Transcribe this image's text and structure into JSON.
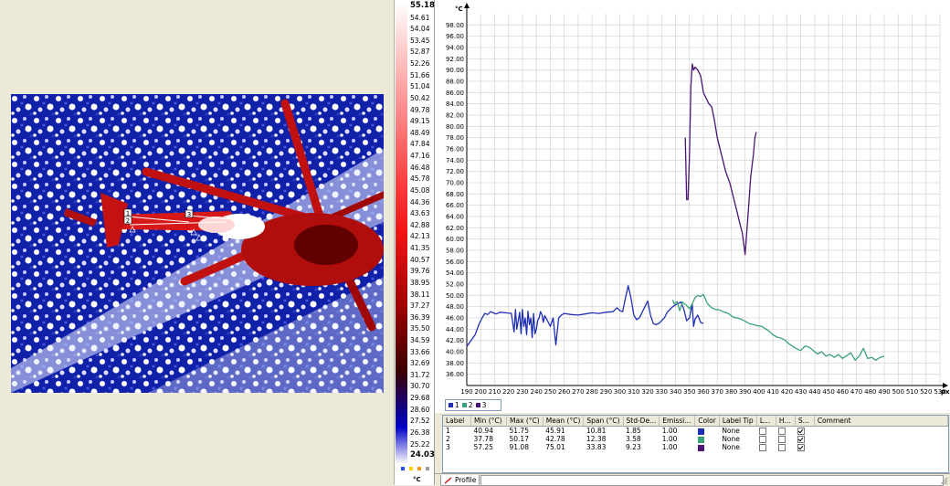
{
  "scale": {
    "labels": [
      "55.18",
      "54.61",
      "54.04",
      "53.45",
      "52.87",
      "52.26",
      "51.66",
      "51.04",
      "50.42",
      "49.78",
      "49.15",
      "48.49",
      "47.84",
      "47.16",
      "46.48",
      "45.78",
      "45.08",
      "44.36",
      "43.63",
      "42.88",
      "42.13",
      "41.35",
      "40.57",
      "39.76",
      "38.95",
      "38.11",
      "37.27",
      "36.39",
      "35.50",
      "34.59",
      "33.66",
      "32.69",
      "31.72",
      "30.70",
      "29.68",
      "28.60",
      "27.52",
      "26.38",
      "25.22",
      "24.03"
    ],
    "max": "55.18",
    "min": "24.03",
    "unit": "°C",
    "icon_colors": [
      "#2050ff",
      "#ffcc00",
      "#ff9a00",
      "#9c9c9c"
    ]
  },
  "image": {
    "markers": [
      "1",
      "2",
      "3"
    ]
  },
  "chart_data": {
    "type": "line",
    "ylabel": "°C",
    "xlabel": "px",
    "xlim": [
      190,
      530
    ],
    "ylim": [
      34,
      100
    ],
    "x_ticks": [
      190,
      200,
      210,
      220,
      230,
      240,
      250,
      260,
      270,
      280,
      290,
      300,
      310,
      320,
      330,
      340,
      350,
      360,
      370,
      380,
      390,
      400,
      410,
      420,
      430,
      440,
      450,
      460,
      470,
      480,
      490,
      500,
      510,
      520,
      530
    ],
    "y_ticks": [
      36,
      38,
      40,
      42,
      44,
      46,
      48,
      50,
      52,
      54,
      56,
      58,
      60,
      62,
      64,
      66,
      68,
      70,
      72,
      74,
      76,
      78,
      80,
      82,
      84,
      86,
      88,
      90,
      92,
      94,
      96,
      98
    ],
    "grid": true,
    "legend_position": "bottom-left",
    "series": [
      {
        "name": "1",
        "color": "#1f2fb5",
        "x": [
          190,
          193,
          196,
          199,
          201,
          203,
          205,
          207,
          209,
          211,
          214,
          218,
          222,
          224,
          225,
          226,
          228,
          229,
          230,
          231,
          232,
          233,
          234,
          235,
          236,
          237,
          238,
          239,
          240,
          241,
          242,
          243,
          244,
          245,
          246,
          248,
          250,
          252,
          254,
          256,
          258,
          260,
          265,
          270,
          275,
          280,
          285,
          290,
          295,
          298,
          300,
          302,
          304,
          306,
          308,
          310,
          312,
          314,
          316,
          318,
          320,
          322,
          324,
          326,
          328,
          330,
          332,
          334,
          336,
          338,
          340,
          342,
          344,
          346,
          348,
          350,
          352,
          353,
          354,
          356,
          358,
          360
        ],
        "values": [
          40.9,
          42,
          43,
          45,
          46,
          46.8,
          46.6,
          47.1,
          46.9,
          46.7,
          47,
          46.9,
          46.8,
          43.5,
          47.5,
          44,
          47,
          43.2,
          47.5,
          44.5,
          46,
          43,
          47.2,
          44.8,
          46,
          42.5,
          46.8,
          43.2,
          44,
          45.6,
          46,
          47.1,
          46.6,
          45.2,
          46.4,
          45.5,
          44.5,
          46,
          41.2,
          46,
          46.5,
          46.8,
          46.6,
          46.5,
          46.7,
          46.9,
          46.8,
          47,
          47.1,
          47.8,
          47.3,
          47.1,
          49.5,
          51.7,
          49.5,
          46.5,
          45.7,
          46,
          47,
          48,
          49,
          46.5,
          45,
          44.8,
          45,
          45.5,
          46,
          47,
          47.5,
          48,
          48.3,
          48.6,
          48.8,
          47.5,
          45.5,
          46,
          48.5,
          44.5,
          45.8,
          46.5,
          45.2,
          45
        ]
      },
      {
        "name": "2",
        "color": "#3aa077",
        "x": [
          338,
          339,
          341,
          343,
          345,
          348,
          350,
          352,
          354,
          356,
          358,
          360,
          363,
          366,
          369,
          372,
          375,
          378,
          381,
          384,
          387,
          390,
          393,
          396,
          399,
          402,
          405,
          408,
          410,
          413,
          416,
          419,
          421,
          424,
          427,
          430,
          433,
          436,
          439,
          442,
          445,
          448,
          451,
          454,
          457,
          460,
          463,
          466,
          469,
          472,
          475,
          478,
          481,
          484,
          487,
          490
        ],
        "values": [
          49.2,
          48.5,
          48.9,
          47.3,
          48.8,
          48.2,
          47.6,
          48.5,
          49.6,
          50,
          49.8,
          50.17,
          48.5,
          47.8,
          47.5,
          47.4,
          47,
          46.8,
          46.2,
          46,
          45.8,
          45.4,
          45,
          44.8,
          44.6,
          44.5,
          44,
          43.5,
          43,
          42.6,
          42.4,
          42,
          41.5,
          41,
          40.5,
          40.2,
          41,
          40.8,
          40.2,
          39.6,
          40,
          39.2,
          39.5,
          39,
          39.5,
          38.8,
          39.3,
          39.8,
          38.5,
          39.2,
          40.6,
          38.8,
          39,
          38.5,
          39,
          39.2
        ]
      },
      {
        "name": "3",
        "color": "#4a1573",
        "x": [
          347,
          348,
          349,
          350,
          351,
          352,
          353,
          354,
          356,
          358,
          360,
          362,
          364,
          366,
          368,
          370,
          373,
          376,
          379,
          381,
          384,
          386,
          388,
          390,
          392,
          394,
          396,
          397,
          398
        ],
        "values": [
          78,
          67,
          67,
          75,
          87,
          91.08,
          90,
          90.5,
          90,
          89,
          86,
          85,
          84,
          83.5,
          81,
          78,
          75,
          72,
          70,
          68,
          65,
          63,
          61,
          57.25,
          64,
          71,
          75,
          78,
          79
        ]
      }
    ]
  },
  "legend": [
    {
      "label": "1",
      "color": "#1f2fb5"
    },
    {
      "label": "2",
      "color": "#3aa077"
    },
    {
      "label": "3",
      "color": "#4a1573"
    }
  ],
  "table": {
    "headers": [
      "Label",
      "Min (°C)",
      "Max (°C)",
      "Mean (°C)",
      "Span (°C)",
      "Std-De...",
      "Emissi...",
      "Color",
      "Label Tip",
      "L...",
      "H...",
      "S...",
      "Comment"
    ],
    "rows": [
      {
        "label": "1",
        "min": "40.94",
        "max": "51.75",
        "mean": "45.91",
        "span": "10.81",
        "std": "1.85",
        "emis": "1.00",
        "color": "#1f2fb5",
        "tip": "None"
      },
      {
        "label": "2",
        "min": "37.78",
        "max": "50.17",
        "mean": "42.78",
        "span": "12.38",
        "std": "3.58",
        "emis": "1.00",
        "color": "#3aa077",
        "tip": "None"
      },
      {
        "label": "3",
        "min": "57.25",
        "max": "91.08",
        "mean": "75.01",
        "span": "33.83",
        "std": "9.23",
        "emis": "1.00",
        "color": "#4a1573",
        "tip": "None"
      }
    ]
  },
  "status": {
    "tab_label": "Profile"
  }
}
